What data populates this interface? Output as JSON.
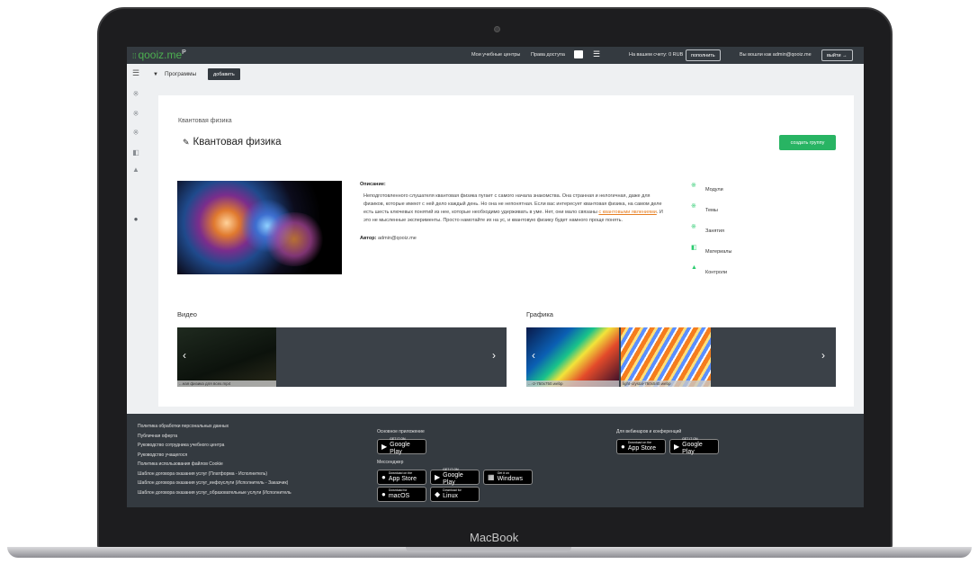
{
  "device": {
    "label": "MacBook"
  },
  "topbar": {
    "logo": "qooiz.me",
    "logo_sup": "P",
    "links": [
      "Мои учебные центры",
      "Права доступа"
    ],
    "balance": "На вашем счету: 0 RUB",
    "topup": "пополнить",
    "logged_as": "Вы вошли как admin@qooiz.me",
    "logout": "выйти →"
  },
  "subbar": {
    "programs": "Программы",
    "add": "добавить"
  },
  "course": {
    "breadcrumb": "Квантовая физика",
    "title": "Квантовая физика",
    "create_group": "создать группу",
    "desc_heading": "Описание:",
    "desc_before": "Неподготовленного слушателя квантовая физика пугает с самого начала знакомства. Она странная и нелогичная, даже для физиков, которые имеют с ней дело каждый день. Но она не непонятная. Если вас интересует квантовая физика, на самом деле есть шесть ключевых понятий из нее, которые необходимо удерживать в уме. Нет, они мало связаны ",
    "desc_link": "с квантовыми явлениями",
    "desc_after": ". И это не мысленные эксперименты. Просто намотайте их на ус, и квантовую физику будет намного проще понять.",
    "author_label": "Автор:",
    "author": "admin@qooiz.me"
  },
  "stats": [
    {
      "icon": "atom-icon",
      "label": "Модули"
    },
    {
      "icon": "atom-icon",
      "label": "Темы"
    },
    {
      "icon": "atom-icon",
      "label": "Занятия"
    },
    {
      "icon": "book-icon",
      "label": "Материалы"
    },
    {
      "icon": "graduation-cap-icon",
      "label": "Контроли"
    }
  ],
  "media": {
    "video_label": "Видео",
    "video_caption": "...ная физика для всех.mp4",
    "graphics_label": "Графика",
    "graphics_captions": [
      "...-2-750x750.webp",
      "light-crystal-750x540.webp"
    ]
  },
  "footer": {
    "links": [
      "Политика обработки персональных данных",
      "Публичная оферта",
      "Руководство сотрудника учебного центра",
      "Руководство учащегося",
      "Политика использования файлов Cookie",
      "Шаблон договора оказания услуг (Платформа - Исполнитель)",
      "Шаблон договора оказания услуг_инфоуслуги (Исполнитель - Заказчик)",
      "Шаблон договора оказания услуг_образовательные услуги (Исполнитель"
    ],
    "main_app": "Основное приложение",
    "messenger": "Мессенджер",
    "webinars": "Для вебинаров и конференций",
    "badges": {
      "gp_small": "GET IT ON",
      "gp": "Google Play",
      "as_small": "Download on the",
      "as": "App Store",
      "win_small": "Get it on",
      "win": "Windows",
      "mac_small": "Download for",
      "mac": "macOS",
      "lin_small": "Download for",
      "lin": "Linux"
    }
  },
  "colors": {
    "accent": "#28b463",
    "dark": "#343a40",
    "link": "#e67e22"
  }
}
